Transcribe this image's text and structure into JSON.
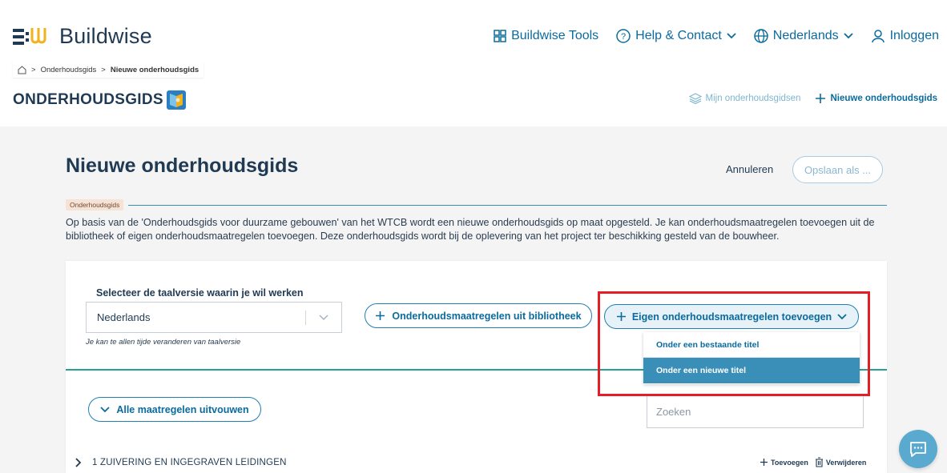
{
  "header": {
    "logo_text": "Buildwise",
    "nav": {
      "tools": "Buildwise Tools",
      "help": "Help & Contact",
      "language": "Nederlands",
      "login": "Inloggen"
    }
  },
  "breadcrumb": {
    "items": [
      "Onderhoudsgids",
      "Nieuwe onderhoudsgids"
    ]
  },
  "brand": {
    "title": "ONDERHOUDSGIDS"
  },
  "subnav": {
    "my_guides": "Mijn onderhoudsgidsen",
    "new_guide": "Nieuwe onderhoudsgids"
  },
  "page": {
    "title": "Nieuwe onderhoudsgids",
    "cancel_label": "Annuleren",
    "save_as_label": "Opslaan als ...",
    "tag": "Onderhoudsgids",
    "intro": "Op basis van de 'Onderhoudsgids voor duurzame gebouwen' van het WTCB wordt een nieuwe onderhoudsgids op maat opgesteld. Je kan onderhoudsmaatregelen toevoegen uit de bibliotheek of eigen onderhoudsmaatregelen toevoegen. Deze onderhoudsgids wordt bij de oplevering van het project ter beschikking gesteld van de bouwheer."
  },
  "card": {
    "language_label": "Selecteer de taalversie waarin je wil werken",
    "language_value": "Nederlands",
    "language_hint": "Je kan te allen tijde veranderen van taalversie",
    "library_button": "Onderhoudsmaatregelen uit bibliotheek",
    "own_button": "Eigen onderhoudsmaatregelen toevoegen",
    "dropdown_items": [
      "Onder een bestaande titel",
      "Onder een nieuwe titel"
    ],
    "expand_button": "Alle maatregelen uitvouwen",
    "search_placeholder": "Zoeken",
    "section": {
      "title": "1 ZUIVERING EN INGEGRAVEN LEIDINGEN",
      "add_label": "Toevoegen",
      "delete_label": "Verwijderen"
    }
  },
  "colors": {
    "primary": "#0a6b9e",
    "accent_teal": "#27a092",
    "highlight_red": "#e31e24",
    "dropdown_active": "#3a8fb9"
  }
}
